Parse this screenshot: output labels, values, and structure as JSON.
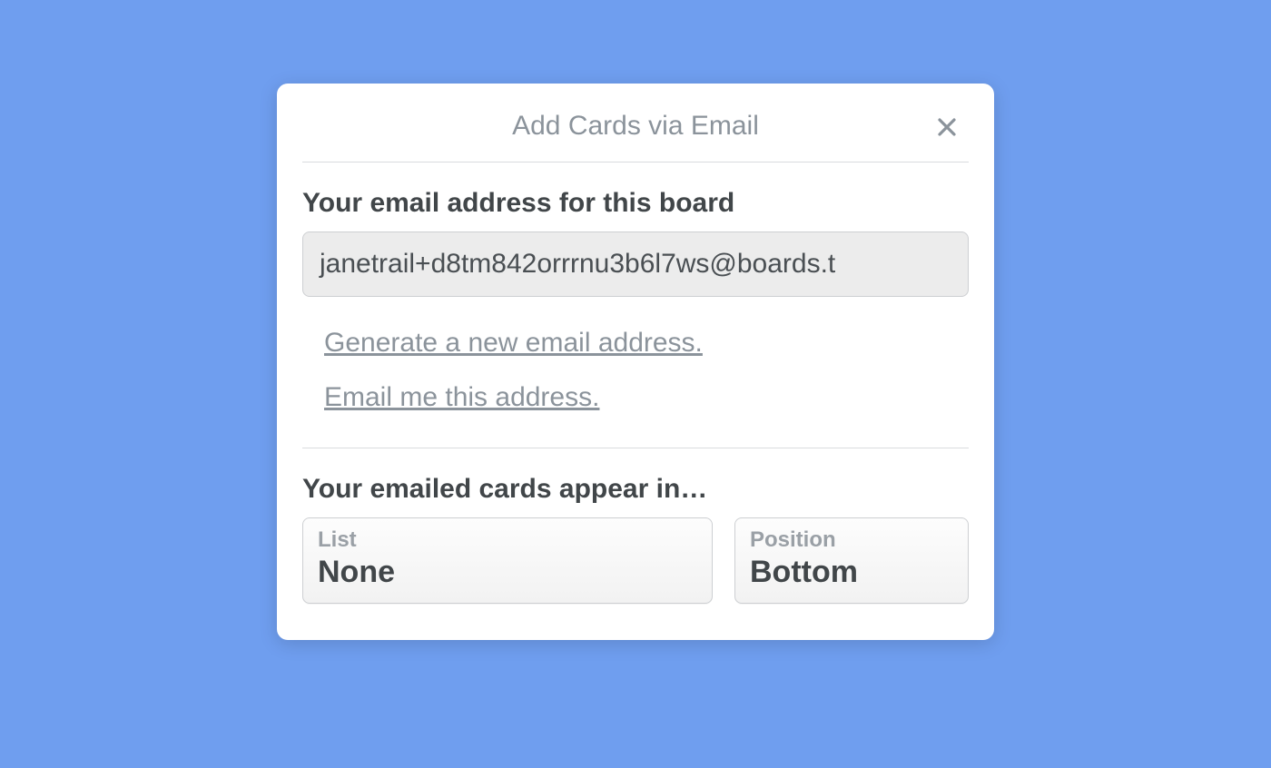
{
  "modal": {
    "title": "Add Cards via Email",
    "section1": {
      "heading": "Your email address for this board",
      "email_value": "janetrail+d8tm842orrrnu3b6l7ws@boards.t",
      "link_generate": "Generate a new email address.",
      "link_email_me": "Email me this address."
    },
    "section2": {
      "heading": "Your emailed cards appear in…",
      "list": {
        "label": "List",
        "value": "None"
      },
      "position": {
        "label": "Position",
        "value": "Bottom"
      }
    }
  }
}
